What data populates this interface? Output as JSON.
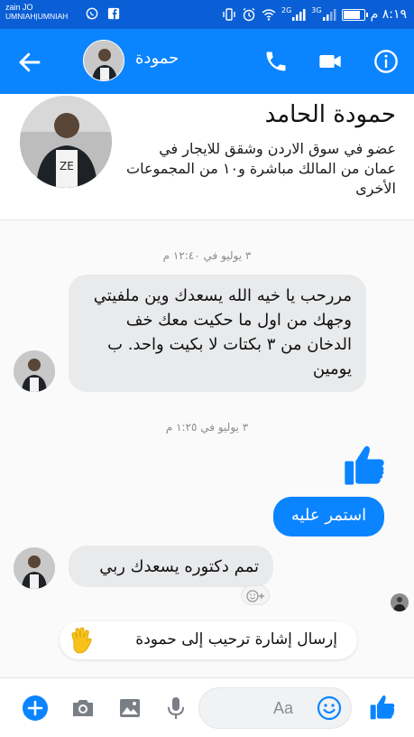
{
  "status_bar": {
    "carrier_line1": "zain JO",
    "carrier_line2": "UMNIAH|UMNIAH",
    "network_1": "2G",
    "network_2": "3G",
    "time": "٨:١٩ م",
    "battery_level": 0.75
  },
  "toolbar": {
    "contact_name": "حمودة",
    "icons": [
      "back-arrow-icon",
      "phone-icon",
      "video-camera-icon",
      "info-icon"
    ]
  },
  "profile": {
    "name": "حمودة الحامد",
    "description": "عضو في سوق الاردن وشقق للايجار في عمان من المالك مباشرة و١٠ من المجموعات الأخرى"
  },
  "messages": {
    "timestamp_1": "٣ يوليو في ١٢:٤٠ م",
    "incoming_1": "مررحب يا خيه الله يسعدك وين ملفيتي وجهك من اول ما حكيت معك خف الدخان من ٣ بكتات لا بكيت واحد. ب يومين",
    "timestamp_2": "٣ يوليو في ١:٢٥ م",
    "outgoing_1": "استمر عليه",
    "incoming_2": "تمم دكتوره يسعدك ربي",
    "wave_prompt": "إرسال إشارة ترحيب إلى حمودة"
  },
  "composer": {
    "placeholder": "Aa",
    "icons": [
      "add-icon",
      "camera-icon",
      "image-icon",
      "microphone-icon",
      "emoji-icon",
      "like-icon"
    ]
  },
  "colors": {
    "status_bar": "#0b5fd6",
    "toolbar": "#0b84ff",
    "incoming_bubble": "#e9eaec",
    "outgoing_bubble": "#0b84ff"
  }
}
